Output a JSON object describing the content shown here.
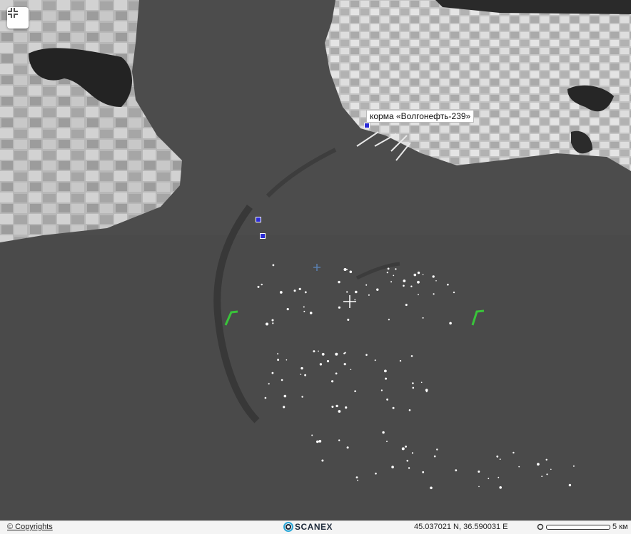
{
  "map": {
    "labels": [
      {
        "text": "корма «Волгонефть-239»"
      }
    ],
    "markers": [
      {
        "type": "square",
        "color": "#2b2bd6"
      },
      {
        "type": "square",
        "color": "#2b2bd6"
      },
      {
        "type": "square",
        "color": "#2b2bd6"
      }
    ],
    "colors": {
      "sea": "#4a4a4a",
      "land": "#b9b9b9",
      "wake_lines": "#39c43a",
      "marker": "#2b2bd6"
    }
  },
  "controls": {
    "fullscreen_icon": "collapse-fullscreen-icon"
  },
  "footer": {
    "copyrights_label": "© Copyrights",
    "logo_text": "SCANEX",
    "coordinates": "45.037021 N, 36.590031 E",
    "scale_label": "5 км"
  }
}
